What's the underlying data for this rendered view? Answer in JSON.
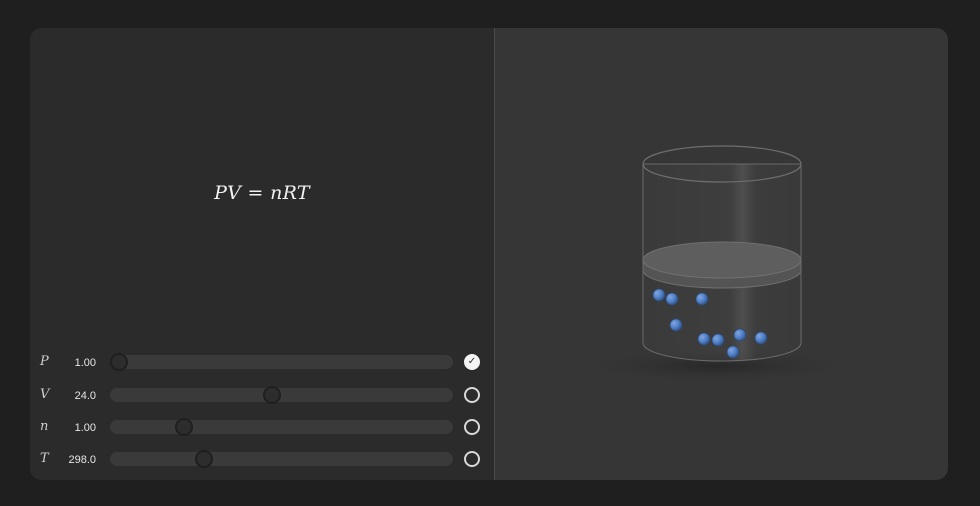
{
  "equation": "PV = nRT",
  "controls": [
    {
      "symbol": "P",
      "value": "1.00",
      "fraction": 0.0,
      "locked": true
    },
    {
      "symbol": "V",
      "value": "24.0",
      "fraction": 0.47,
      "locked": false
    },
    {
      "symbol": "n",
      "value": "1.00",
      "fraction": 0.2,
      "locked": false
    },
    {
      "symbol": "T",
      "value": "298.0",
      "fraction": 0.26,
      "locked": false
    }
  ],
  "colors": {
    "background": "#1f1f1f",
    "panel": "#2b2b2b",
    "scene": "#363636",
    "particle": "#4f7fc6"
  },
  "icons": {
    "lock_checked": "check-circle-icon",
    "lock_unchecked": "empty-circle-icon"
  }
}
